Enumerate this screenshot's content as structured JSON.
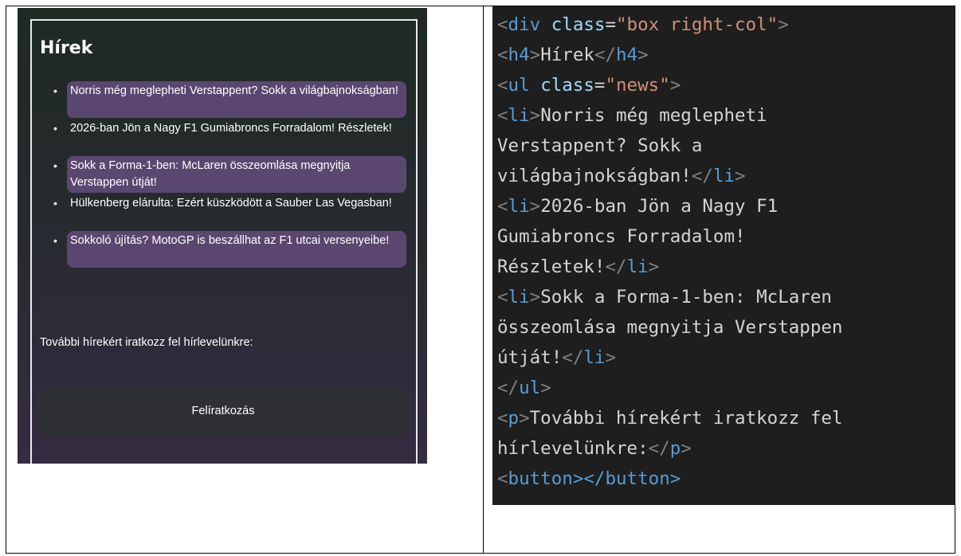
{
  "preview": {
    "title": "Hírek",
    "news": [
      {
        "text": "Norris még meglepheti Verstappent? Sokk a világbajnokságban!",
        "highlighted": true
      },
      {
        "text": "2026-ban Jön a Nagy F1 Gumiabroncs Forradalom! Részletek!",
        "highlighted": false
      },
      {
        "text": "Sokk a Forma-1-ben: McLaren összeomlása megnyitja Verstappen útját!",
        "highlighted": true
      },
      {
        "text": "Hülkenberg elárulta: Ezért küszködött a Sauber Las Vegasban!",
        "highlighted": false
      },
      {
        "text": "Sokkoló újítás? MotoGP is beszállhat az F1 utcai versenyeibe!",
        "highlighted": true
      }
    ],
    "subscribe_text": "További hírekért iratkozz fel hírlevelünkre:",
    "subscribe_button": "Felíratkozás",
    "bullet_char": "•"
  },
  "code": {
    "l1": {
      "open": "<",
      "tag": "div",
      "sp": " ",
      "attr": "class",
      "eq": "=",
      "val": "\"box right-col\"",
      "close": ">"
    },
    "l2": {
      "o1": "<",
      "tag": "h4",
      "c1": ">",
      "text": "Hírek",
      "o2": "</",
      "tag2": "h4",
      "c2": ">"
    },
    "l3": {
      "open": "<",
      "tag": "ul",
      "sp": " ",
      "attr": "class",
      "eq": "=",
      "val": "\"news\"",
      "close": ">"
    },
    "l4": {
      "o1": "<",
      "tag": "li",
      "c1": ">",
      "text": "Norris még meglepheti"
    },
    "l5": {
      "text": "Verstappent? Sokk a"
    },
    "l6": {
      "text": "világbajnokságban!",
      "o2": "</",
      "tag2": "li",
      "c2": ">"
    },
    "l7": {
      "o1": "<",
      "tag": "li",
      "c1": ">",
      "text": "2026-ban Jön a Nagy F1"
    },
    "l8": {
      "text": "Gumiabroncs Forradalom!"
    },
    "l9": {
      "text": "Részletek!",
      "o2": "</",
      "tag2": "li",
      "c2": ">"
    },
    "l10": {
      "o1": "<",
      "tag": "li",
      "c1": ">",
      "text": "Sokk a Forma-1-ben: McLaren"
    },
    "l11": {
      "text": "összeomlása megnyitja Verstappen"
    },
    "l12": {
      "text": "útját!",
      "o2": "</",
      "tag2": "li",
      "c2": ">"
    },
    "l13": {
      "o2": "</",
      "tag2": "ul",
      "c2": ">"
    },
    "l14": {
      "o1": "<",
      "tag": "p",
      "c1": ">",
      "text": "További hírekért iratkozz fel"
    },
    "l15": {
      "text": "hírlevelünkre:",
      "o2": "</",
      "tag2": "p",
      "c2": ">"
    },
    "l16": {
      "o1": "<",
      "tag": "button",
      "c1": "></",
      "tag2": "button",
      "c2": ">"
    }
  },
  "colors": {
    "tag": "#569cd6",
    "attr": "#9cdcfe",
    "string": "#ce9178",
    "punctuation": "#808080",
    "highlight": "#5a4770",
    "code_bg": "#1e1e1e"
  }
}
